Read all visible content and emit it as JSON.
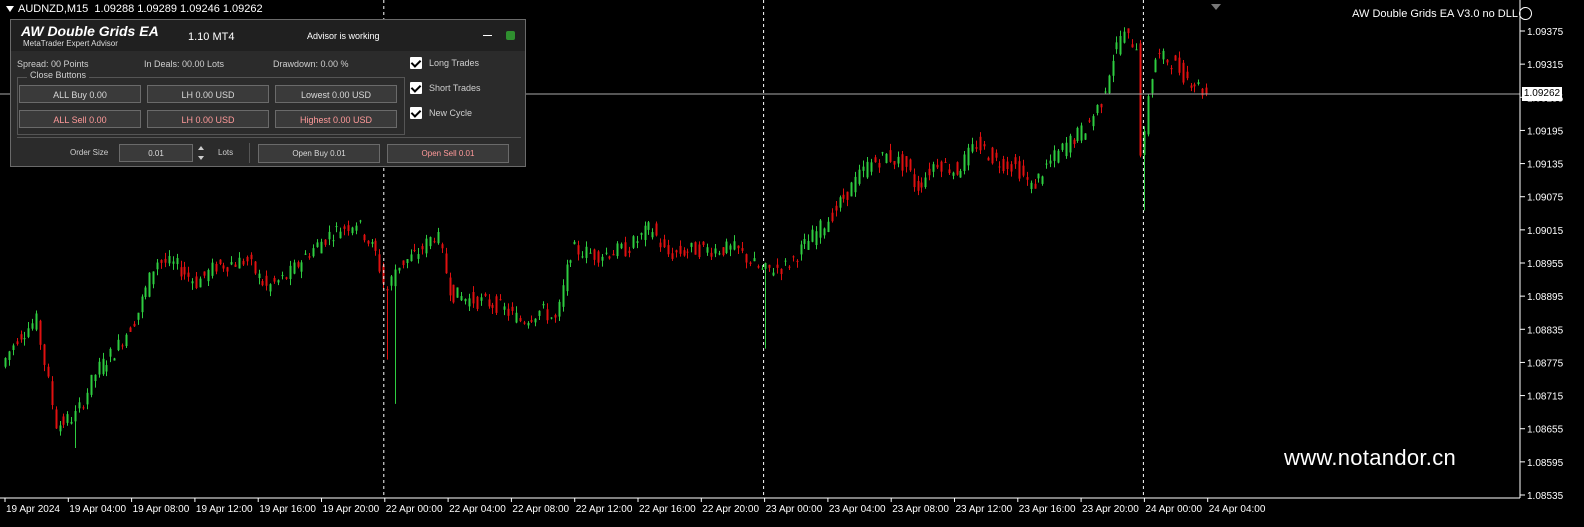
{
  "chart": {
    "symbol": "AUDNZD,M15",
    "ohlc": "1.09288 1.09289 1.09246 1.09262",
    "ea_title": "AW Double Grids EA  V3.0 no DLL",
    "current_price": "1.09262",
    "watermark": "www.notandor.cn",
    "price_ticks": [
      "1.09375",
      "1.09315",
      "1.09255",
      "1.09195",
      "1.09135",
      "1.09075",
      "1.09015",
      "1.08955",
      "1.08895",
      "1.08835",
      "1.08775",
      "1.08715",
      "1.08655",
      "1.08595",
      "1.08535"
    ],
    "time_ticks": [
      "19 Apr 2024",
      "19 Apr 04:00",
      "19 Apr 08:00",
      "19 Apr 12:00",
      "19 Apr 16:00",
      "19 Apr 20:00",
      "22 Apr 00:00",
      "22 Apr 04:00",
      "22 Apr 08:00",
      "22 Apr 12:00",
      "22 Apr 16:00",
      "22 Apr 20:00",
      "23 Apr 00:00",
      "23 Apr 04:00",
      "23 Apr 08:00",
      "23 Apr 12:00",
      "23 Apr 16:00",
      "23 Apr 20:00",
      "24 Apr 00:00",
      "24 Apr 04:00"
    ],
    "session_separators": [
      "22 Apr 00:00",
      "23 Apr 00:00",
      "24 Apr 00:00"
    ],
    "colors": {
      "bull": "#2ecc40",
      "bear": "#e01010",
      "background": "#000000",
      "axis": "#ffffff"
    }
  },
  "panel": {
    "brand": "AW Double Grids EA",
    "brand_sub": "MetaTrader Expert Advisor",
    "version": "1.10 MT4",
    "status": "Advisor is working",
    "spread": "Spread: 00 Points",
    "in_deals": "In Deals: 00.00 Lots",
    "drawdown": "Drawdown: 0.00 %",
    "close_group": "Close Buttons",
    "buttons": {
      "all_buy": "ALL Buy 0.00",
      "lh_buy": "LH 0.00 USD",
      "lowest": "Lowest 0.00 USD",
      "all_sell": "ALL Sell 0.00",
      "lh_sell": "LH 0.00 USD",
      "highest": "Highest 0.00 USD"
    },
    "checks": {
      "long": "Long Trades",
      "short": "Short Trades",
      "new_cycle": "New Cycle"
    },
    "order_size_label": "Order Size",
    "order_size_value": "0.01",
    "lots_label": "Lots",
    "open_buy": "Open Buy 0.01",
    "open_sell": "Open Sell 0.01"
  }
}
